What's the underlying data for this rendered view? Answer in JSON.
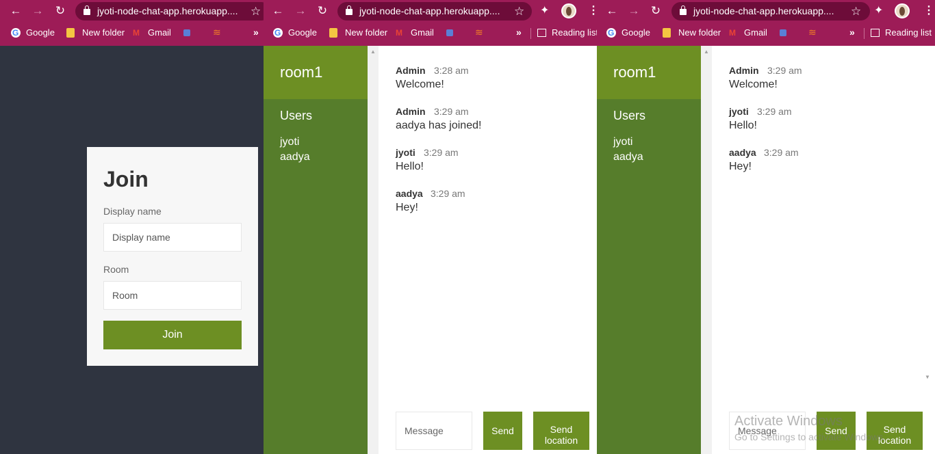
{
  "browser": {
    "url": "jyoti-node-chat-app.herokuapp....",
    "bookmarks": {
      "google": "Google",
      "new_folder": "New folder",
      "gmail": "Gmail",
      "reading_list": "Reading list",
      "more": "»"
    },
    "colors": {
      "frame": "#9d1c57",
      "omnibox": "#6d0c39"
    }
  },
  "join": {
    "title": "Join",
    "display_name_label": "Display name",
    "display_name_placeholder": "Display name",
    "room_label": "Room",
    "room_placeholder": "Room",
    "button": "Join"
  },
  "chat_a": {
    "room": "room1",
    "users_heading": "Users",
    "users": [
      "jyoti",
      "aadya"
    ],
    "messages": [
      {
        "name": "Admin",
        "time": "3:28 am",
        "text": "Welcome!"
      },
      {
        "name": "Admin",
        "time": "3:29 am",
        "text": "aadya has joined!"
      },
      {
        "name": "jyoti",
        "time": "3:29 am",
        "text": "Hello!"
      },
      {
        "name": "aadya",
        "time": "3:29 am",
        "text": "Hey!"
      }
    ],
    "message_placeholder": "Message",
    "send": "Send",
    "send_location_1": "Send",
    "send_location_2": "location"
  },
  "chat_b": {
    "room": "room1",
    "users_heading": "Users",
    "users": [
      "jyoti",
      "aadya"
    ],
    "messages": [
      {
        "name": "Admin",
        "time": "3:29 am",
        "text": "Welcome!"
      },
      {
        "name": "jyoti",
        "time": "3:29 am",
        "text": "Hello!"
      },
      {
        "name": "aadya",
        "time": "3:29 am",
        "text": "Hey!"
      }
    ],
    "message_placeholder": "Message",
    "send": "Send",
    "send_location_1": "Send",
    "send_location_2": "location"
  },
  "watermark": {
    "line1": "Activate Windows",
    "line2": "Go to Settings to activate Windows."
  },
  "theme": {
    "sidebar": "#567d2b",
    "accent": "#6d8f23",
    "page_bg": "#2f3440"
  }
}
